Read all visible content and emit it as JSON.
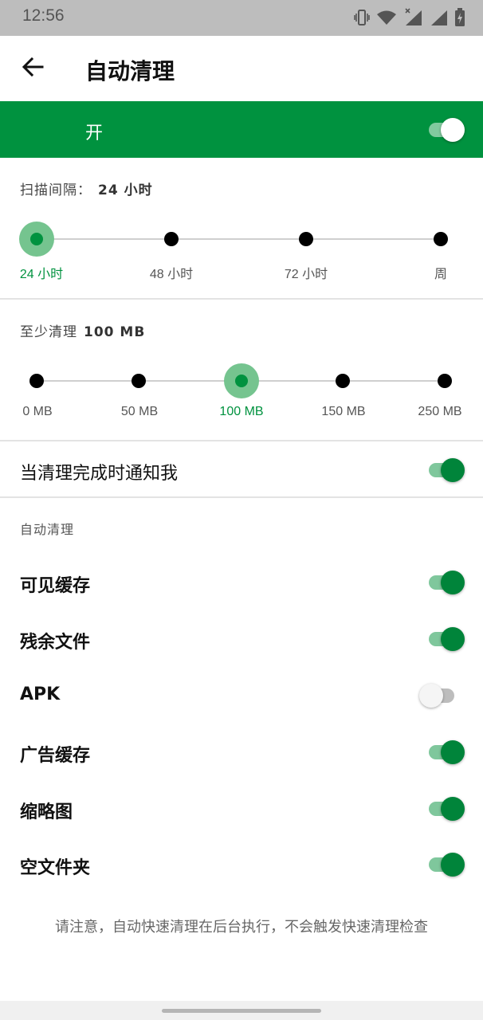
{
  "status_bar": {
    "time": "12:56",
    "icons": [
      "vibrate-icon",
      "wifi-icon",
      "signal-x-icon",
      "signal-icon",
      "battery-charging-icon"
    ]
  },
  "app_bar": {
    "back_icon": "arrow-left-icon",
    "title": "自动清理"
  },
  "master_switch": {
    "label": "开",
    "state": "on"
  },
  "scan_interval": {
    "label": "扫描间隔：",
    "value": "24 小时",
    "options": [
      "24 小时",
      "48 小时",
      "72 小时",
      "周"
    ],
    "selected_index": 0
  },
  "min_clean": {
    "label": "至少清理",
    "value": "100 MB",
    "options": [
      "0 MB",
      "50 MB",
      "100 MB",
      "150 MB",
      "250 MB"
    ],
    "selected_index": 2
  },
  "notify": {
    "label": "当清理完成时通知我",
    "state": "on"
  },
  "auto_clean": {
    "header": "自动清理",
    "items": [
      {
        "label": "可见缓存",
        "state": "on"
      },
      {
        "label": "残余文件",
        "state": "on"
      },
      {
        "label": "APK",
        "state": "off"
      },
      {
        "label": "广告缓存",
        "state": "on"
      },
      {
        "label": "缩略图",
        "state": "on"
      },
      {
        "label": "空文件夹",
        "state": "on"
      }
    ]
  },
  "footer_note": "请注意，自动快速清理在后台执行，不会触发快速清理检查",
  "colors": {
    "accent": "#00923f",
    "toggle_on_thumb": "#00843a",
    "toggle_on_track": "#7fc79c",
    "status_bar": "#bdbdbd"
  }
}
